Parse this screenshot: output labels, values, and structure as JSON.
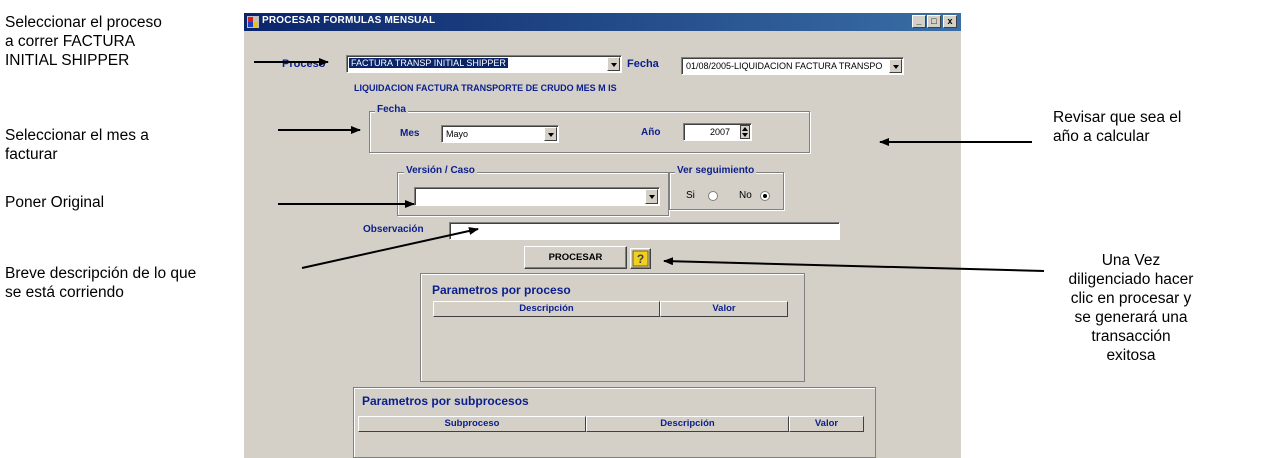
{
  "callouts": {
    "proceso": [
      "Seleccionar el proceso",
      "a correr FACTURA",
      "INITIAL SHIPPER"
    ],
    "mes": [
      "Seleccionar el mes a",
      "facturar"
    ],
    "original": [
      "Poner Original"
    ],
    "descripcion": [
      "Breve descripción de lo que",
      "se está corriendo"
    ],
    "anio": [
      "Revisar que sea el",
      "año a calcular"
    ],
    "procesar": [
      "Una Vez",
      "diligenciado hacer",
      "clic en procesar y",
      "se generará una",
      "transacción",
      "exitosa"
    ]
  },
  "window": {
    "title": "PROCESAR FORMULAS MENSUAL",
    "min": "_",
    "max": "□",
    "close": "x"
  },
  "form": {
    "proceso_label": "Proceso",
    "proceso_value": "FACTURA TRANSP INITIAL SHIPPER",
    "fecha_label": "Fecha",
    "fecha_value": "01/08/2005-LIQUIDACION FACTURA TRANSPO",
    "description": "LIQUIDACION FACTURA TRANSPORTE DE CRUDO MES M IS",
    "fecha_group": "Fecha",
    "mes_label": "Mes",
    "mes_value": "Mayo",
    "anio_label": "Año",
    "anio_value": "2007",
    "version_group": "Versión / Caso",
    "version_value": "",
    "seguimiento_group": "Ver seguimiento",
    "si_label": "Si",
    "no_label": "No",
    "seguimiento_selected": "No",
    "observacion_label": "Observación",
    "observacion_value": "",
    "procesar_button": "PROCESAR"
  },
  "panels": {
    "proceso": {
      "title": "Parametros por proceso",
      "columns": [
        "Descripción",
        "Valor"
      ]
    },
    "subprocesos": {
      "title": "Parametros por subprocesos",
      "columns": [
        "Subproceso",
        "Descripción",
        "Valor"
      ]
    }
  },
  "colors": {
    "window_bg": "#d4d0c8",
    "title_bar": "#0a246a",
    "label_blue": "#0a1e8c"
  }
}
